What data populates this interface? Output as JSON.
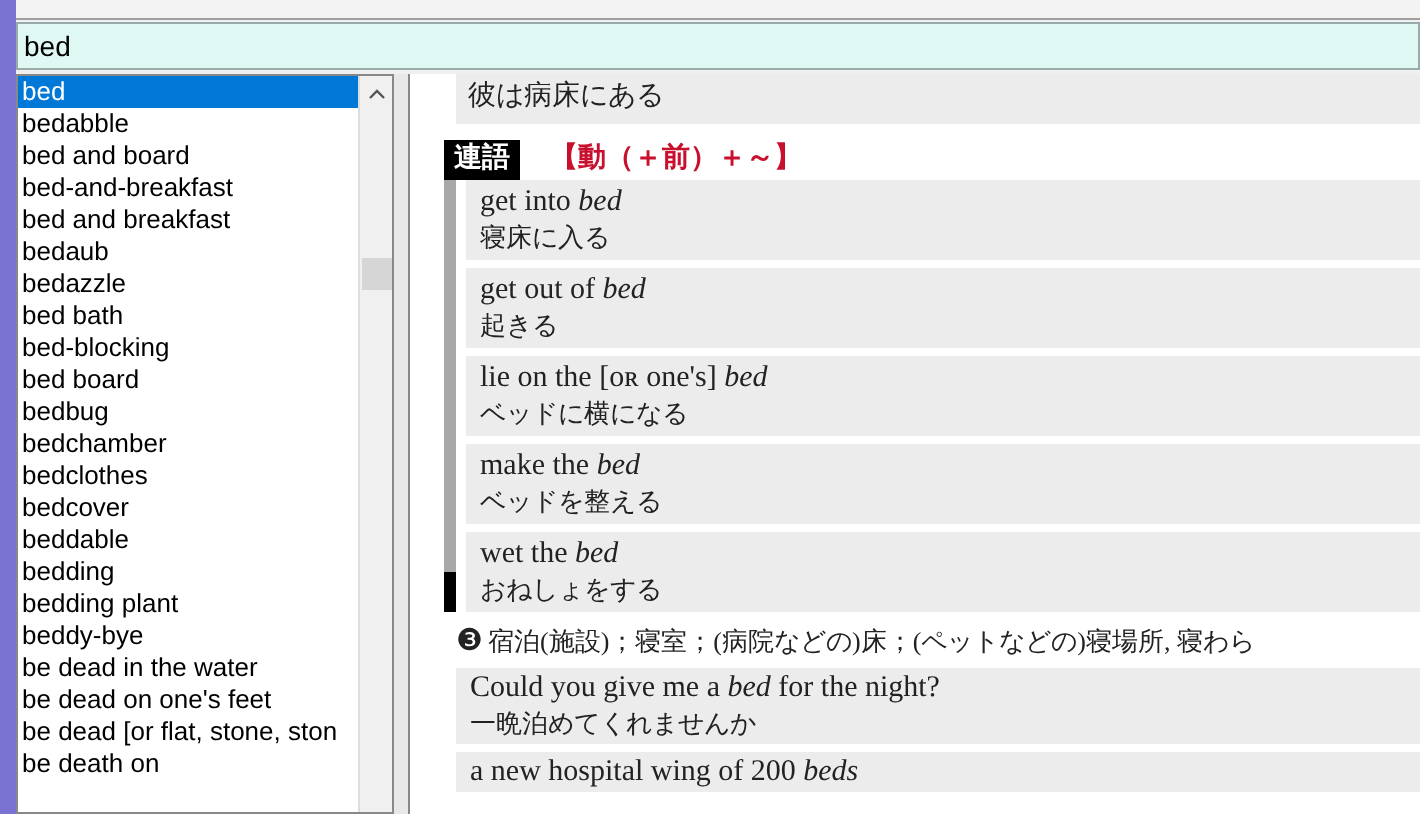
{
  "search": {
    "value": "bed"
  },
  "word_list": [
    {
      "label": "bed",
      "selected": true
    },
    {
      "label": "bedabble",
      "selected": false
    },
    {
      "label": "bed and board",
      "selected": false
    },
    {
      "label": "bed-and-breakfast",
      "selected": false
    },
    {
      "label": "bed and breakfast",
      "selected": false
    },
    {
      "label": "bedaub",
      "selected": false
    },
    {
      "label": "bedazzle",
      "selected": false
    },
    {
      "label": "bed bath",
      "selected": false
    },
    {
      "label": "bed-blocking",
      "selected": false
    },
    {
      "label": "bed board",
      "selected": false
    },
    {
      "label": "bedbug",
      "selected": false
    },
    {
      "label": "bedchamber",
      "selected": false
    },
    {
      "label": "bedclothes",
      "selected": false
    },
    {
      "label": "bedcover",
      "selected": false
    },
    {
      "label": "beddable",
      "selected": false
    },
    {
      "label": "bedding",
      "selected": false
    },
    {
      "label": "bedding plant",
      "selected": false
    },
    {
      "label": "beddy-bye",
      "selected": false
    },
    {
      "label": "be dead in the water",
      "selected": false
    },
    {
      "label": "be dead on one's feet",
      "selected": false
    },
    {
      "label": "be dead [or flat, stone, ston",
      "selected": false
    },
    {
      "label": "be death on",
      "selected": false
    }
  ],
  "entry": {
    "top_example_translation": "彼は病床にある",
    "collocations": {
      "tag": "連語",
      "pattern": "【動（＋前）＋～】",
      "items": [
        {
          "english": "get into *bed*",
          "japanese": "寝床に入る"
        },
        {
          "english": "get out of *bed*",
          "japanese": "起きる"
        },
        {
          "english": "lie on the [ᴏʀ one's] *bed*",
          "japanese": "ベッドに横になる"
        },
        {
          "english": "make the *bed*",
          "japanese": "ベッドを整える"
        },
        {
          "english": "wet the *bed*",
          "japanese": "おねしょをする"
        }
      ]
    },
    "sense": {
      "number": "❸",
      "definition": "宿泊(施設)；寝室；(病院などの)床；(ペットなどの)寝場所, 寝わら"
    },
    "examples": [
      {
        "english": "Could you give me a *bed* for the night?",
        "japanese": "一晩泊めてくれませんか"
      },
      {
        "english": "a new hospital wing of 200 *beds*"
      }
    ]
  }
}
